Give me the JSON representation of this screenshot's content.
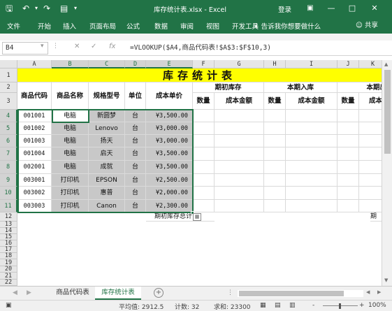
{
  "window": {
    "title": "库存统计表.xlsx - Excel",
    "login": "登录",
    "icons": [
      "save-icon",
      "undo-icon",
      "redo-icon",
      "form-icon",
      "dropdown-icon",
      "ribbon-options-icon",
      "minimize-icon",
      "maximize-icon",
      "close-icon"
    ]
  },
  "ribbon": {
    "tabs": [
      "文件",
      "开始",
      "插入",
      "页面布局",
      "公式",
      "数据",
      "审阅",
      "视图",
      "开发工具"
    ],
    "tell_me": "告诉我你想要做什么",
    "share": "共享"
  },
  "formula_bar": {
    "name_box": "B4",
    "formula": "=VLOOKUP($A4,商品代码表!$A$3:$F$10,3)",
    "fx": "fx"
  },
  "grid": {
    "columns": [
      "A",
      "B",
      "C",
      "D",
      "E",
      "F",
      "G",
      "H",
      "I",
      "J",
      "K"
    ],
    "rows": [
      "1",
      "2",
      "3",
      "4",
      "5",
      "6",
      "7",
      "8",
      "9",
      "10",
      "11",
      "12",
      "13",
      "14",
      "15",
      "16",
      "17",
      "18",
      "19",
      "20",
      "21",
      "22"
    ],
    "title": "库存统计表",
    "headers": {
      "a": "商品代码",
      "b": "商品名称",
      "c": "规格型号",
      "d": "单位",
      "e": "成本单价",
      "period_open": "期初库存",
      "period_in": "本期入库",
      "period_out": "本期出",
      "qty": "数量",
      "amount": "成本金额",
      "k_partial": "成本"
    },
    "data": [
      {
        "code": "001001",
        "name": "电脑",
        "spec": "新圆梦",
        "unit": "台",
        "price": "¥3,500.00"
      },
      {
        "code": "001002",
        "name": "电脑",
        "spec": "Lenovo",
        "unit": "台",
        "price": "¥3,000.00"
      },
      {
        "code": "001003",
        "name": "电脑",
        "spec": "扬天",
        "unit": "台",
        "price": "¥3,000.00"
      },
      {
        "code": "001004",
        "name": "电脑",
        "spec": "启天",
        "unit": "台",
        "price": "¥3,500.00"
      },
      {
        "code": "002001",
        "name": "电脑",
        "spec": "成就",
        "unit": "台",
        "price": "¥3,500.00"
      },
      {
        "code": "003001",
        "name": "打印机",
        "spec": "EPSON",
        "unit": "台",
        "price": "¥2,500.00"
      },
      {
        "code": "003002",
        "name": "打印机",
        "spec": "惠普",
        "unit": "台",
        "price": "¥2,000.00"
      },
      {
        "code": "003003",
        "name": "打印机",
        "spec": "Canon",
        "unit": "台",
        "price": "¥2,300.00"
      }
    ],
    "row12_text": "期初库存总计",
    "row12_right": "期"
  },
  "sheets": {
    "tabs": [
      "商品代码表",
      "库存统计表"
    ],
    "active": 1
  },
  "status": {
    "average": "平均值: 2912.5",
    "count": "计数: 32",
    "sum": "求和: 23300",
    "zoom": "100%",
    "zoom_minus": "-",
    "zoom_plus": "+"
  }
}
